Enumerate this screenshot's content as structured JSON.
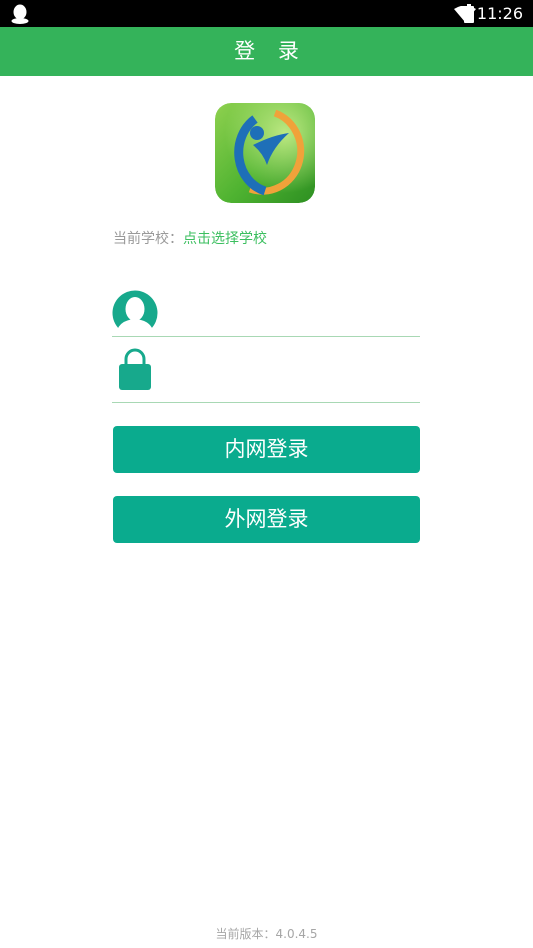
{
  "status_bar": {
    "time": "11:26",
    "icons": [
      "qq-penguin-icon",
      "wifi-icon",
      "battery-icon"
    ]
  },
  "header": {
    "title": "登 录"
  },
  "logo": {
    "icon": "app-logo-icon"
  },
  "school": {
    "label": "当前学校：",
    "value": "点击选择学校"
  },
  "form": {
    "username": {
      "icon": "user-avatar-icon",
      "value": "",
      "placeholder": ""
    },
    "password": {
      "icon": "lock-icon",
      "value": "",
      "placeholder": ""
    }
  },
  "buttons": {
    "intranet_login": "内网登录",
    "extranet_login": "外网登录"
  },
  "footer": {
    "version": "当前版本：4.0.4.5"
  },
  "colors": {
    "title_bar": "#34b35a",
    "button": "#0aab8e",
    "icon": "#17a98c",
    "link": "#3bbf5f"
  }
}
